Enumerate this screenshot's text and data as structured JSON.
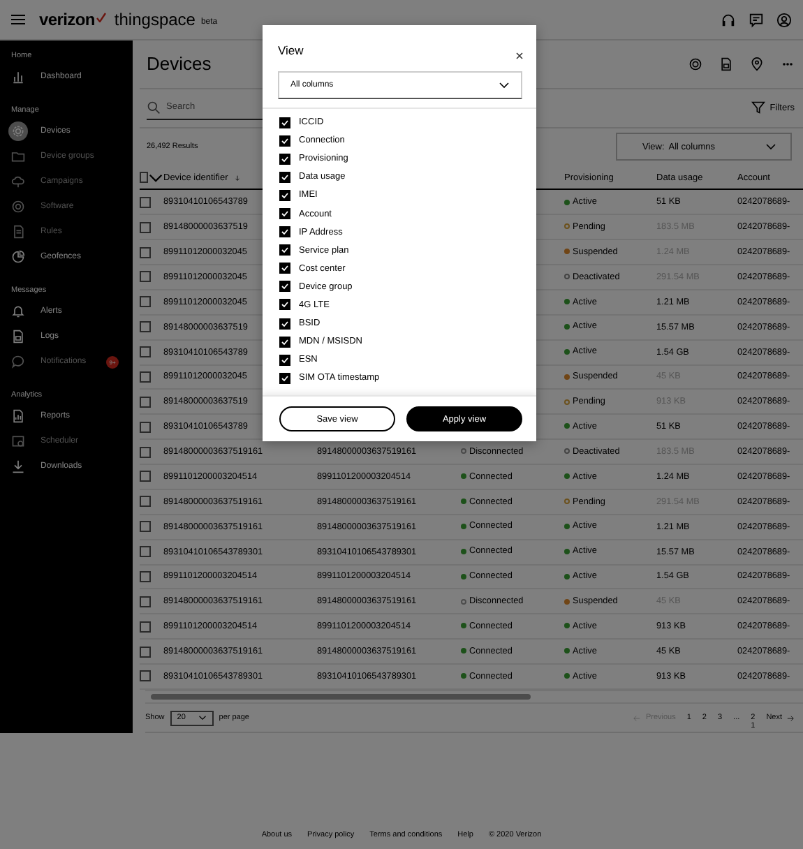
{
  "header": {
    "brand": "verizon",
    "product": "thingspace",
    "tag": "beta"
  },
  "sidebar": {
    "sections": [
      {
        "label": "Home",
        "items": [
          {
            "label": "Dashboard",
            "selected": false,
            "disabled": false
          }
        ]
      },
      {
        "label": "Manage",
        "items": [
          {
            "label": "Devices",
            "selected": true,
            "disabled": false
          },
          {
            "label": "Device groups",
            "selected": false,
            "disabled": true
          },
          {
            "label": "Campaigns",
            "selected": false,
            "disabled": true
          },
          {
            "label": "Software",
            "selected": false,
            "disabled": true
          },
          {
            "label": "Rules",
            "selected": false,
            "disabled": true
          },
          {
            "label": "Geofences",
            "selected": false,
            "disabled": false
          }
        ]
      },
      {
        "label": "Messages",
        "items": [
          {
            "label": "Alerts",
            "selected": false,
            "disabled": false
          },
          {
            "label": "Logs",
            "selected": false,
            "disabled": false
          },
          {
            "label": "Notifications",
            "selected": false,
            "disabled": true,
            "badge": "9+"
          }
        ]
      },
      {
        "label": "Analytics",
        "items": [
          {
            "label": "Reports",
            "selected": false,
            "disabled": false
          },
          {
            "label": "Scheduler",
            "selected": false,
            "disabled": true
          },
          {
            "label": "Downloads",
            "selected": false,
            "disabled": false
          }
        ]
      }
    ]
  },
  "page": {
    "title": "Devices",
    "search": {
      "placeholder": "Search"
    },
    "filters": "Filters",
    "results": "26,492 Results",
    "view_select": {
      "label": "View:",
      "value": "All columns"
    }
  },
  "table": {
    "all_checked": false,
    "columns": [
      {
        "label": "Device identifier",
        "sorted": true
      },
      {
        "label": "Provisioning"
      },
      {
        "label": "Data usage"
      },
      {
        "label": "Account"
      }
    ],
    "rows": [
      {
        "checked": false,
        "device_identifier": "89310410106543789",
        "provisioning": {
          "label": "Active",
          "kind": "active"
        },
        "data_usage": "51 KB",
        "account": "0242078689-"
      },
      {
        "checked": false,
        "device_identifier": "89148000003637519",
        "provisioning": {
          "label": "Pending",
          "kind": "pending"
        },
        "data_usage": "183.5 MB",
        "account": "0242078689-"
      },
      {
        "checked": false,
        "device_identifier": "89911012000032045",
        "provisioning": {
          "label": "Suspended",
          "kind": "suspended"
        },
        "data_usage": "1.24 MB",
        "account": "0242078689-"
      },
      {
        "checked": false,
        "device_identifier": "89911012000032045",
        "provisioning": {
          "label": "Deactivated",
          "kind": "deactivated"
        },
        "data_usage": "291.54 MB",
        "account": "0242078689-"
      },
      {
        "checked": false,
        "device_identifier": "89911012000032045",
        "provisioning": {
          "label": "Active",
          "kind": "active"
        },
        "data_usage": "1.21 MB",
        "account": "0242078689-"
      },
      {
        "checked": false,
        "device_identifier": "89148000003637519",
        "provisioning": {
          "label": "Active",
          "kind": "active"
        },
        "data_usage": "15.57 MB",
        "account": "0242078689-"
      },
      {
        "checked": false,
        "device_identifier": "89310410106543789",
        "provisioning": {
          "label": "Active",
          "kind": "active"
        },
        "data_usage": "1.54 GB",
        "account": "0242078689-"
      },
      {
        "checked": false,
        "device_identifier": "89911012000032045",
        "provisioning": {
          "label": "Suspended",
          "kind": "suspended"
        },
        "data_usage": "45 KB",
        "account": "0242078689-"
      },
      {
        "checked": false,
        "device_identifier": "89148000003637519",
        "provisioning": {
          "label": "Pending",
          "kind": "pending"
        },
        "data_usage": "913 KB",
        "account": "0242078689-"
      },
      {
        "checked": false,
        "device_identifier": "89310410106543789",
        "provisioning": {
          "label": "Active",
          "kind": "active"
        },
        "data_usage": "51 KB",
        "account": "0242078689-"
      },
      {
        "checked": false,
        "device_identifier": "89148000003637519161",
        "column_2": "89148000003637519161",
        "column_3": {
          "label": "Disconnected",
          "kind": "disconnected"
        },
        "provisioning": {
          "label": "Deactivated",
          "kind": "deactivated"
        },
        "data_usage": "183.5 MB",
        "account": "0242078689-"
      },
      {
        "checked": false,
        "device_identifier": "8991101200003204514",
        "column_2": "8991101200003204514",
        "column_3": {
          "label": "Connected",
          "kind": "connected"
        },
        "provisioning": {
          "label": "Active",
          "kind": "active"
        },
        "data_usage": "1.24 MB",
        "account": "0242078689-"
      },
      {
        "checked": false,
        "device_identifier": "89148000003637519161",
        "column_2": "89148000003637519161",
        "column_3": {
          "label": "Connected",
          "kind": "connected"
        },
        "provisioning": {
          "label": "Pending",
          "kind": "pending"
        },
        "data_usage": "291.54 MB",
        "account": "0242078689-"
      },
      {
        "checked": false,
        "device_identifier": "89148000003637519161",
        "column_2": "89148000003637519161",
        "column_3": {
          "label": "Connected",
          "kind": "connected"
        },
        "provisioning": {
          "label": "Active",
          "kind": "active"
        },
        "data_usage": "1.21 MB",
        "account": "0242078689-"
      },
      {
        "checked": false,
        "device_identifier": "89310410106543789301",
        "column_2": "89310410106543789301",
        "column_3": {
          "label": "Connected",
          "kind": "connected"
        },
        "provisioning": {
          "label": "Active",
          "kind": "active"
        },
        "data_usage": "15.57 MB",
        "account": "0242078689-"
      },
      {
        "checked": false,
        "device_identifier": "8991101200003204514",
        "column_2": "8991101200003204514",
        "column_3": {
          "label": "Connected",
          "kind": "connected"
        },
        "provisioning": {
          "label": "Active",
          "kind": "active"
        },
        "data_usage": "1.54 GB",
        "account": "0242078689-"
      },
      {
        "checked": false,
        "device_identifier": "89148000003637519161",
        "column_2": "89148000003637519161",
        "column_3": {
          "label": "Disconnected",
          "kind": "disconnected"
        },
        "provisioning": {
          "label": "Suspended",
          "kind": "suspended"
        },
        "data_usage": "45 KB",
        "account": "0242078689-"
      },
      {
        "checked": false,
        "device_identifier": "8991101200003204514",
        "column_2": "8991101200003204514",
        "column_3": {
          "label": "Connected",
          "kind": "connected"
        },
        "provisioning": {
          "label": "Active",
          "kind": "active"
        },
        "data_usage": "913 KB",
        "account": "0242078689-"
      },
      {
        "checked": false,
        "device_identifier": "89148000003637519161",
        "column_2": "89148000003637519161",
        "column_3": {
          "label": "Connected",
          "kind": "connected"
        },
        "provisioning": {
          "label": "Active",
          "kind": "active"
        },
        "data_usage": "45 KB",
        "account": "0242078689-"
      },
      {
        "checked": false,
        "device_identifier": "89310410106543789301",
        "column_2": "89310410106543789301",
        "column_3": {
          "label": "Connected",
          "kind": "connected"
        },
        "provisioning": {
          "label": "Active",
          "kind": "active"
        },
        "data_usage": "913 KB",
        "account": "0242078689-"
      }
    ]
  },
  "pagination": {
    "show": "Show",
    "per_page_value": "20",
    "per_page": "per page",
    "previous": {
      "label": "Previous",
      "disabled": true
    },
    "pages": [
      "1",
      "2",
      "3",
      "...",
      "21"
    ],
    "next": {
      "label": "Next",
      "disabled": false
    }
  },
  "footer": {
    "links": [
      "About us",
      "Privacy policy",
      "Terms and conditions",
      "Help"
    ],
    "copyright": "© 2020 Verizon"
  },
  "modal": {
    "title": "View",
    "select": {
      "value": "All columns"
    },
    "options": [
      {
        "label": "ICCID",
        "checked": true
      },
      {
        "label": "Connection",
        "checked": true
      },
      {
        "label": "Provisioning",
        "checked": true
      },
      {
        "label": "Data usage",
        "checked": true
      },
      {
        "label": "IMEI",
        "checked": true
      },
      {
        "label": "Account",
        "checked": true
      },
      {
        "label": "IP Address",
        "checked": true
      },
      {
        "label": "Service plan",
        "checked": true
      },
      {
        "label": "Cost center",
        "checked": true
      },
      {
        "label": "Device group",
        "checked": true
      },
      {
        "label": "4G LTE",
        "checked": true
      },
      {
        "label": "BSID",
        "checked": true
      },
      {
        "label": "MDN / MSISDN",
        "checked": true
      },
      {
        "label": "ESN",
        "checked": true
      },
      {
        "label": "SIM OTA timestamp",
        "checked": true
      }
    ],
    "buttons": [
      {
        "label": "Save view",
        "kind": "secondary"
      },
      {
        "label": "Apply view",
        "kind": "primary"
      }
    ]
  }
}
